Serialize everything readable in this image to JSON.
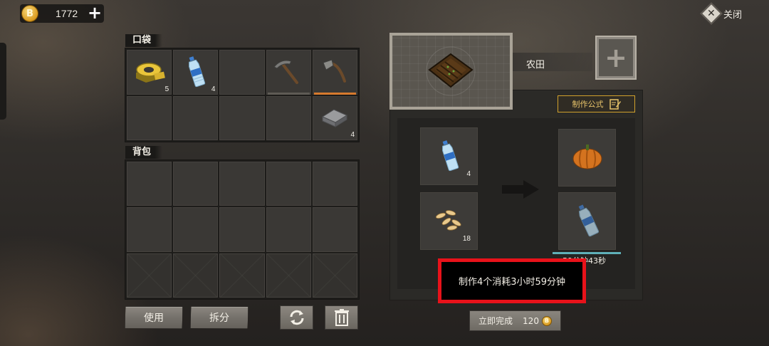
{
  "top_bar": {
    "coin_symbol": "B",
    "currency_amount": "1772",
    "add_label": "+",
    "close_label": "关闭",
    "close_symbol": "✕"
  },
  "pocket": {
    "title": "口袋",
    "slots": [
      {
        "item": "duct-tape",
        "count": "5"
      },
      {
        "item": "water-bottle",
        "count": "4"
      },
      {
        "item": "",
        "count": ""
      },
      {
        "item": "pickaxe",
        "count": ""
      },
      {
        "item": "hatchet",
        "count": ""
      },
      {
        "item": "",
        "count": ""
      },
      {
        "item": "",
        "count": ""
      },
      {
        "item": "",
        "count": ""
      },
      {
        "item": "",
        "count": ""
      },
      {
        "item": "iron-ingot",
        "count": "4"
      }
    ]
  },
  "backpack": {
    "title": "背包",
    "rows": 3,
    "cols": 5
  },
  "actions": {
    "use_label": "使用",
    "split_label": "拆分"
  },
  "crafter": {
    "title": "农田",
    "add_symbol": "+",
    "formula_label": "制作公式",
    "inputs": [
      {
        "item": "water-bottle",
        "count": "4"
      },
      {
        "item": "seeds",
        "count": "18"
      }
    ],
    "outputs": [
      {
        "item": "pumpkin"
      },
      {
        "item": "water-bottle"
      }
    ],
    "progress": 1.0,
    "timer_text": "59分钟43秒",
    "info_text": "制作4个消耗3小时59分钟",
    "finish_label": "立即完成",
    "finish_cost": "120",
    "colors": {
      "highlight_border": "#e8121a",
      "formula_gold": "#d1a12c",
      "progress_teal": "#5fb0b8"
    }
  }
}
